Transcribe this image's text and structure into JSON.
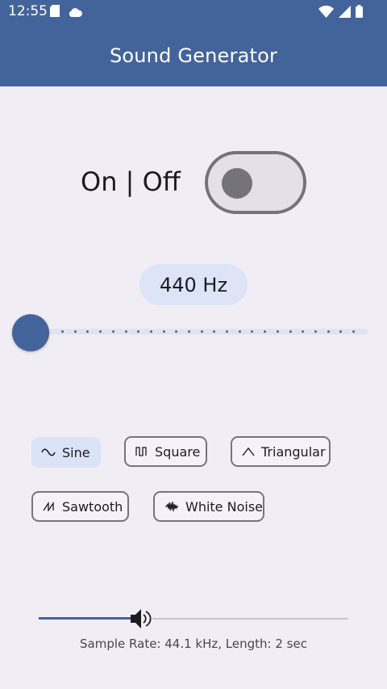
{
  "status_bar": {
    "time": "12:55",
    "left_icons": [
      "sd-card-icon",
      "cloud-icon"
    ],
    "right_icons": [
      "wifi-icon",
      "cell-signal-icon",
      "battery-icon"
    ]
  },
  "app_bar": {
    "title": "Sound Generator"
  },
  "power": {
    "label": "On | Off",
    "state": "off"
  },
  "frequency": {
    "value_label": "440 Hz",
    "slider_position": 0
  },
  "waveforms": [
    {
      "label": "Sine",
      "icon": "sine-wave-icon",
      "selected": true
    },
    {
      "label": "Square",
      "icon": "square-wave-icon",
      "selected": false
    },
    {
      "label": "Triangular",
      "icon": "triangle-wave-icon",
      "selected": false
    },
    {
      "label": "Sawtooth",
      "icon": "sawtooth-wave-icon",
      "selected": false
    },
    {
      "label": "White Noise",
      "icon": "noise-wave-icon",
      "selected": false
    }
  ],
  "volume": {
    "level": 0.33
  },
  "footer": {
    "sample_info": "Sample Rate: 44.1 kHz, Length: 2 sec"
  },
  "colors": {
    "primary": "#43649a",
    "background": "#f1edf4",
    "chip_selected": "#dbe3f6",
    "freq_pill": "#dde4f8"
  }
}
